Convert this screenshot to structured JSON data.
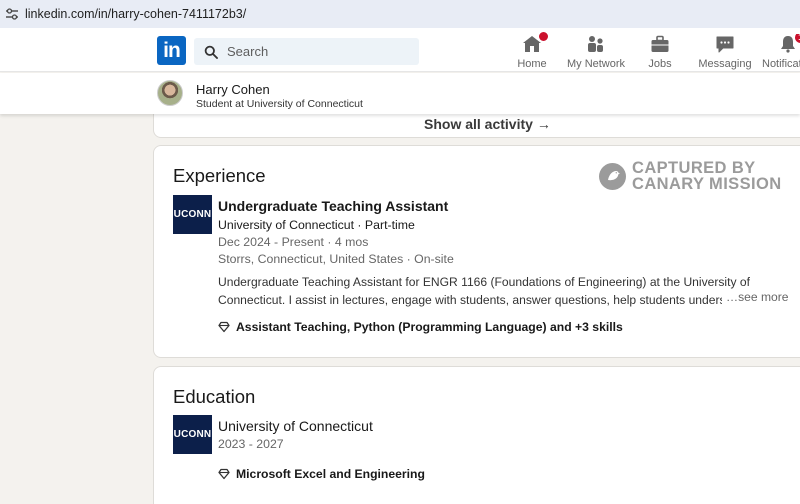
{
  "browser": {
    "url": "linkedin.com/in/harry-cohen-7411172b3/",
    "icon": "site-settings-icon"
  },
  "nav": {
    "logo_text": "in",
    "search_placeholder": "Search",
    "items": [
      {
        "label": "Home",
        "icon": "home-icon",
        "badge": ""
      },
      {
        "label": "My Network",
        "icon": "network-icon"
      },
      {
        "label": "Jobs",
        "icon": "briefcase-icon"
      },
      {
        "label": "Messaging",
        "icon": "messaging-icon"
      },
      {
        "label": "Notificati",
        "icon": "bell-icon",
        "badge": "1"
      }
    ]
  },
  "profile": {
    "name": "Harry Cohen",
    "headline": "Student at University of Connecticut"
  },
  "activity": {
    "show_all": "Show all activity →"
  },
  "watermark": {
    "line1": "CAPTURED BY",
    "line2": "CANARY MISSION"
  },
  "experience": {
    "title": "Experience",
    "logo_text": "UCONN",
    "role": "Undergraduate Teaching Assistant",
    "company_type": "University of Connecticut · Part-time",
    "dates": "Dec 2024 - Present · 4 mos",
    "location": "Storrs, Connecticut, United States · On-site",
    "description": "Undergraduate Teaching Assistant for ENGR 1166 (Foundations of Engineering) at the University of Connecticut. I assist in lectures, engage with students, answer questions, help students understand the course mater",
    "see_more": "…see more",
    "skills": "Assistant Teaching, Python (Programming Language) and +3 skills"
  },
  "education": {
    "title": "Education",
    "logo_text": "UCONN",
    "school": "University of Connecticut",
    "years": "2023 - 2027",
    "skills": "Microsoft Excel and Engineering"
  },
  "colors": {
    "brand": "#0a66c2",
    "uconn_navy": "#0c1f4a",
    "badge": "#cb112d"
  }
}
